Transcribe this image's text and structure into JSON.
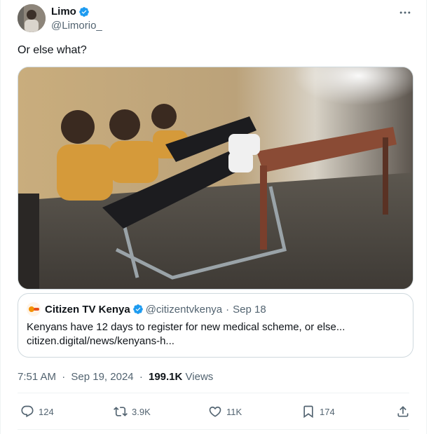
{
  "author": {
    "display_name": "Limo",
    "handle": "@Limorio_"
  },
  "tweet": {
    "text": "Or else what?"
  },
  "quote": {
    "display_name": "Citizen TV Kenya",
    "handle": "@citizentvkenya",
    "dot": "·",
    "date": "Sep 18",
    "text": "Kenyans have 12 days to register for new medical scheme, or else...",
    "link": "citizen.digital/news/kenyans-h..."
  },
  "meta": {
    "time": "7:51 AM",
    "sep1": "·",
    "date": "Sep 19, 2024",
    "sep2": "·",
    "views_count": "199.1K",
    "views_label": "Views"
  },
  "actions": {
    "replies": "124",
    "retweets": "3.9K",
    "likes": "11K",
    "bookmarks": "174"
  },
  "colors": {
    "verified": "#1d9bf0",
    "text_primary": "#0f1419",
    "text_secondary": "#536471",
    "border": "#cfd9de"
  },
  "icons": {
    "more": "more-horizontal-icon",
    "verified": "verified-badge-icon",
    "reply": "reply-icon",
    "retweet": "retweet-icon",
    "like": "heart-icon",
    "bookmark": "bookmark-icon",
    "share": "share-icon"
  }
}
